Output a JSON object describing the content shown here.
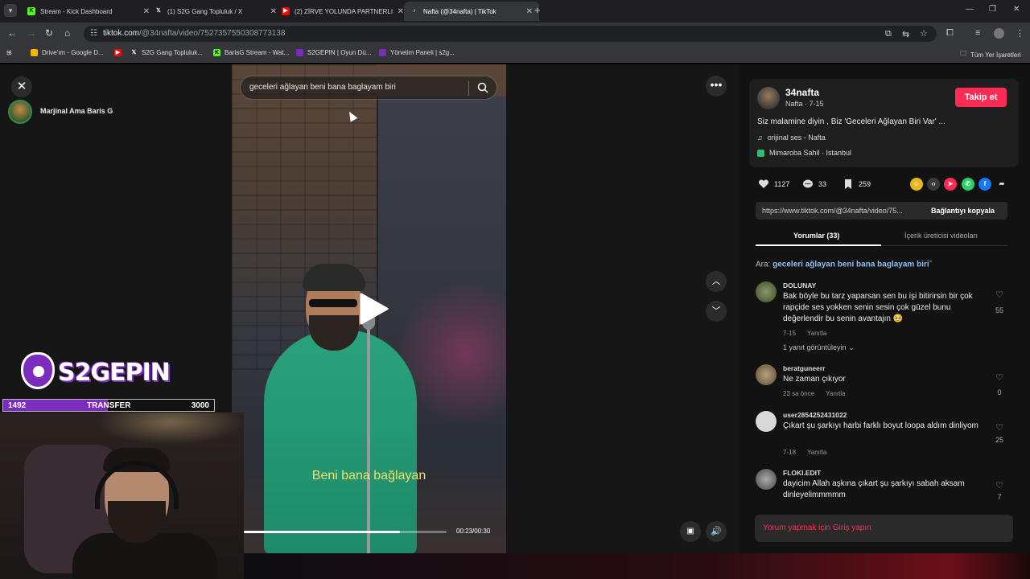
{
  "browser": {
    "tabs": [
      {
        "title": "Stream - Kick Dashboard",
        "icon": "kick-icon",
        "color": "#53fc18"
      },
      {
        "title": "(1) S2G Gang Topluluk / X",
        "icon": "x-icon",
        "color": "#ffffff"
      },
      {
        "title": "(2) ZİRVE YOLUNDA PARTNERLI",
        "icon": "youtube-icon",
        "color": "#ff0000"
      },
      {
        "title": "Nafta (@34nafta) | TikTok",
        "icon": "tiktok-icon",
        "color": "#ffffff"
      }
    ],
    "url_host": "tiktok.com",
    "url_path": "/@34nafta/video/7527357550308773138",
    "bookmarks": [
      {
        "label": "Drive'ım - Google D...",
        "icon": "drive-icon"
      },
      {
        "label": "",
        "icon": "youtube-icon"
      },
      {
        "label": "S2G Gang Topluluk...",
        "icon": "x-icon"
      },
      {
        "label": "BarisG Stream - Wat...",
        "icon": "kick-icon"
      },
      {
        "label": "S2GEPIN | Oyun Dü...",
        "icon": "s2gepin-icon"
      },
      {
        "label": "Yönetim Paneli | s2g...",
        "icon": "s2gepin-icon"
      }
    ],
    "all_bookmarks": "Tüm Yer İşaretleri"
  },
  "stream_overlay": {
    "streamer_name": "Marjinal Ama Baris G",
    "logo_text": "S2GEPIN",
    "transfer_current": "1492",
    "transfer_label": "TRANSFER",
    "transfer_goal": "3000",
    "transfer_fraction": 0.497
  },
  "video": {
    "search_query": "geceleri ağlayan beni bana baglayam biri",
    "subtitle": "Beni bana bağlayan",
    "time": "00:23/00:30",
    "progress_fraction": 0.77
  },
  "author": {
    "username": "34nafta",
    "nickname_date": "Nafta · 7-15",
    "follow_label": "Takip et",
    "description": "Siz malamine diyin , Biz 'Geceleri Ağlayan Biri Var' ...",
    "music": "orijinal ses - Nafta",
    "location": "Mimaroba Sahil · Istanbul"
  },
  "stats": {
    "likes": "1127",
    "comments": "33",
    "saves": "259"
  },
  "link": {
    "url": "https://www.tiktok.com/@34nafta/video/75...",
    "copy_label": "Bağlantıyı kopyala"
  },
  "tabs": {
    "comments": "Yorumlar (33)",
    "creator_videos": "İçerik üreticisi videoları"
  },
  "search_hint": {
    "prefix": "Ara:",
    "query": "geceleri ağlayan beni bana baglayam biri"
  },
  "comments": [
    {
      "user": "DOLUNAY",
      "text": "Bak böyle bu tarz yaparsan sen bu işi bitirirsin bir çok rapçide ses yokken senin sesin çok güzel bunu değerlendir bu senin avantajın 🥺",
      "date": "7-15",
      "reply": "Yanıtla",
      "likes": "55"
    },
    {
      "user": "beratguneerr",
      "text": "Ne zaman çıkıyor",
      "date": "23 sa önce",
      "reply": "Yanıtla",
      "likes": "0"
    },
    {
      "user": "user2854252431022",
      "text": "Çıkart şu şarkıyı harbi farklı boyut loopa aldım dinliyom",
      "date": "7-18",
      "reply": "Yanıtla",
      "likes": "25"
    },
    {
      "user": "FLOKI.EDIT",
      "text": "dayicim Allah aşkına çıkart şu şarkıyı sabah aksam dinleyelimmmmm",
      "date": "",
      "reply": "",
      "likes": "7"
    }
  ],
  "view_replies": "1 yanıt görüntüleyin",
  "login_prompt": "Yorum yapmak için Giriş yapın"
}
